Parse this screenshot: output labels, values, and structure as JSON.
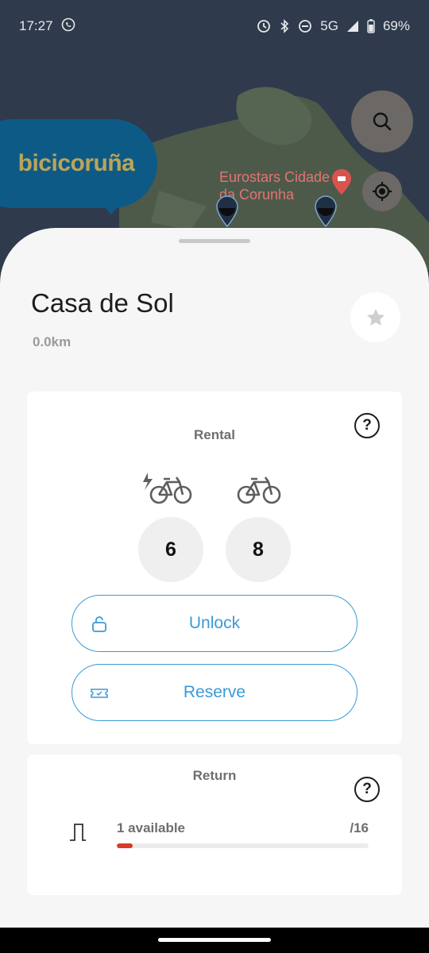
{
  "status_bar": {
    "time": "17:27",
    "network": "5G",
    "battery": "69%"
  },
  "map": {
    "brand": "bicicoruña",
    "poi_label_line1": "Eurostars Cidade",
    "poi_label_line2": "da Corunha"
  },
  "station": {
    "name": "Casa de Sol",
    "distance": "0.0km"
  },
  "rental": {
    "title": "Rental",
    "ebike_count": "6",
    "bike_count": "8",
    "unlock_label": "Unlock",
    "reserve_label": "Reserve"
  },
  "return": {
    "title": "Return",
    "available_label": "1 available",
    "capacity_label": "/16",
    "fill_fraction": 0.0625
  },
  "colors": {
    "accent": "#3a9ad6",
    "bar_fill": "#d93a2a",
    "brand_bg": "#0e5a86"
  },
  "icons": {
    "help": "?"
  }
}
